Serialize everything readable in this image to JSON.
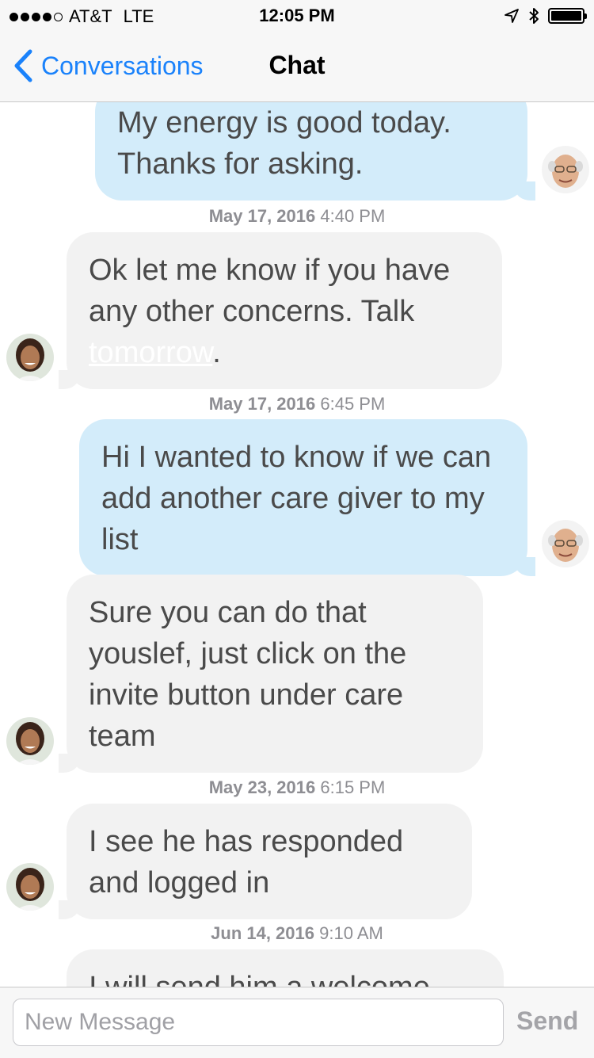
{
  "status_bar": {
    "carrier": "AT&T",
    "network": "LTE",
    "time": "12:05 PM",
    "signal_bars": 4,
    "signal_max": 5,
    "battery_level": 1.0,
    "icons": [
      "location-arrow-icon",
      "bluetooth-icon",
      "battery-icon"
    ]
  },
  "nav": {
    "back_label": "Conversations",
    "title": "Chat",
    "accent_color": "#1a82fb"
  },
  "messages": [
    {
      "type": "out",
      "text": "My energy is good today. Thanks for asking.",
      "avatar": "elderly-man-avatar"
    },
    {
      "type": "timestamp",
      "date": "May 17, 2016",
      "time": "4:40 PM"
    },
    {
      "type": "in",
      "text_before": "Ok let me know if you have any other concerns. Talk ",
      "link_text": "tomorrow",
      "text_after": ".",
      "avatar": "caregiver-woman-avatar"
    },
    {
      "type": "timestamp",
      "date": "May 17, 2016",
      "time": "6:45 PM"
    },
    {
      "type": "out",
      "text": "Hi I wanted to know if we can add another care giver to my list",
      "avatar": "elderly-man-avatar"
    },
    {
      "type": "in",
      "text": "Sure you can do that youslef, just click on the invite button under care team",
      "avatar": "caregiver-woman-avatar"
    },
    {
      "type": "timestamp",
      "date": "May 23, 2016",
      "time": "6:15 PM"
    },
    {
      "type": "in",
      "text": "I see he has responded and logged in",
      "avatar": "caregiver-woman-avatar"
    },
    {
      "type": "timestamp",
      "date": "Jun 14, 2016",
      "time": "9:10 AM"
    },
    {
      "type": "in",
      "text": "I will send him a welcome",
      "avatar": "caregiver-woman-avatar"
    }
  ],
  "input": {
    "placeholder": "New Message",
    "value": "",
    "send_label": "Send"
  },
  "colors": {
    "outgoing_bubble": "#d3ecfa",
    "incoming_bubble": "#f2f2f2",
    "timestamp": "#8e8e93",
    "send_disabled": "#a4a4a8"
  }
}
